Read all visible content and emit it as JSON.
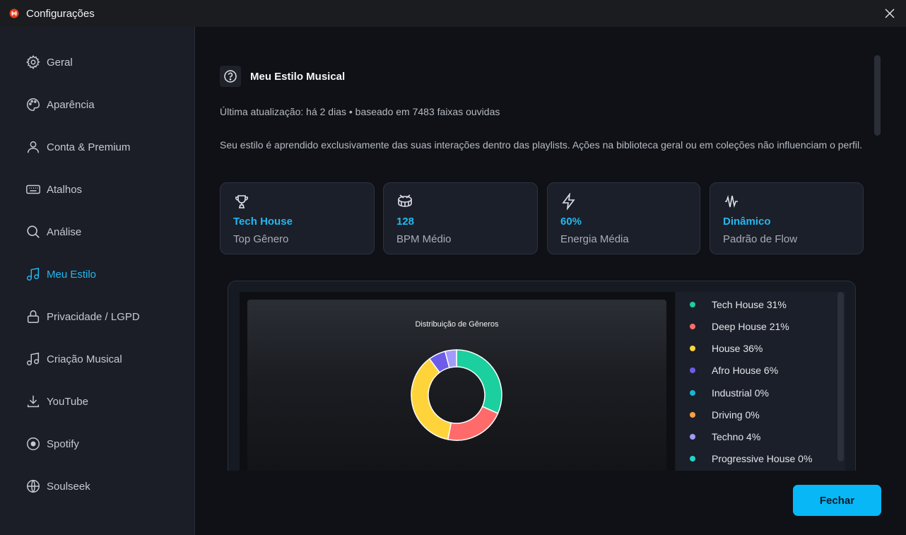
{
  "window": {
    "title": "Configurações"
  },
  "sidebar": {
    "items": [
      {
        "label": "Geral",
        "icon": "gear-icon",
        "active": false
      },
      {
        "label": "Aparência",
        "icon": "palette-icon",
        "active": false
      },
      {
        "label": "Conta & Premium",
        "icon": "user-icon",
        "active": false
      },
      {
        "label": "Atalhos",
        "icon": "keyboard-icon",
        "active": false
      },
      {
        "label": "Análise",
        "icon": "search-icon",
        "active": false
      },
      {
        "label": "Meu Estilo",
        "icon": "music-note-icon",
        "active": true
      },
      {
        "label": "Privacidade / LGPD",
        "icon": "lock-icon",
        "active": false
      },
      {
        "label": "Criação Musical",
        "icon": "music-note-icon",
        "active": false
      },
      {
        "label": "YouTube",
        "icon": "download-icon",
        "active": false
      },
      {
        "label": "Spotify",
        "icon": "target-icon",
        "active": false
      },
      {
        "label": "Soulseek",
        "icon": "globe-icon",
        "active": false
      }
    ]
  },
  "main": {
    "section_title": "Meu Estilo Musical",
    "updated": "Última atualização: há 2 dias  •  baseado em 7483 faixas ouvidas",
    "description": "Seu estilo é aprendido exclusivamente das suas interações dentro das playlists. Ações na biblioteca geral ou em coleções não influenciam o perfil.",
    "stats": [
      {
        "value": "Tech House",
        "label": "Top Gênero",
        "icon": "trophy-icon"
      },
      {
        "value": "128",
        "label": "BPM Médio",
        "icon": "drum-icon"
      },
      {
        "value": "60%",
        "label": "Energia Média",
        "icon": "lightning-icon"
      },
      {
        "value": "Dinâmico",
        "label": "Padrão de Flow",
        "icon": "waveform-icon"
      }
    ],
    "close_label": "Fechar"
  },
  "chart_data": {
    "type": "pie",
    "title": "Distribuição de Gêneros",
    "donut": true,
    "legend_position": "right",
    "categories": [
      "Tech House",
      "Deep House",
      "House",
      "Afro House",
      "Industrial",
      "Driving",
      "Techno",
      "Progressive House"
    ],
    "values": [
      31,
      21,
      36,
      6,
      0,
      0,
      4,
      0
    ],
    "labels": [
      "Tech House  31%",
      "Deep House  21%",
      "House  36%",
      "Afro House  6%",
      "Industrial  0%",
      "Driving  0%",
      "Techno  4%",
      "Progressive House  0%"
    ],
    "colors": [
      "#1ccf9f",
      "#ff6b6b",
      "#ffd43b",
      "#6c5ce7",
      "#18b6d4",
      "#ff9f43",
      "#a29bfe",
      "#22d4c8"
    ]
  }
}
